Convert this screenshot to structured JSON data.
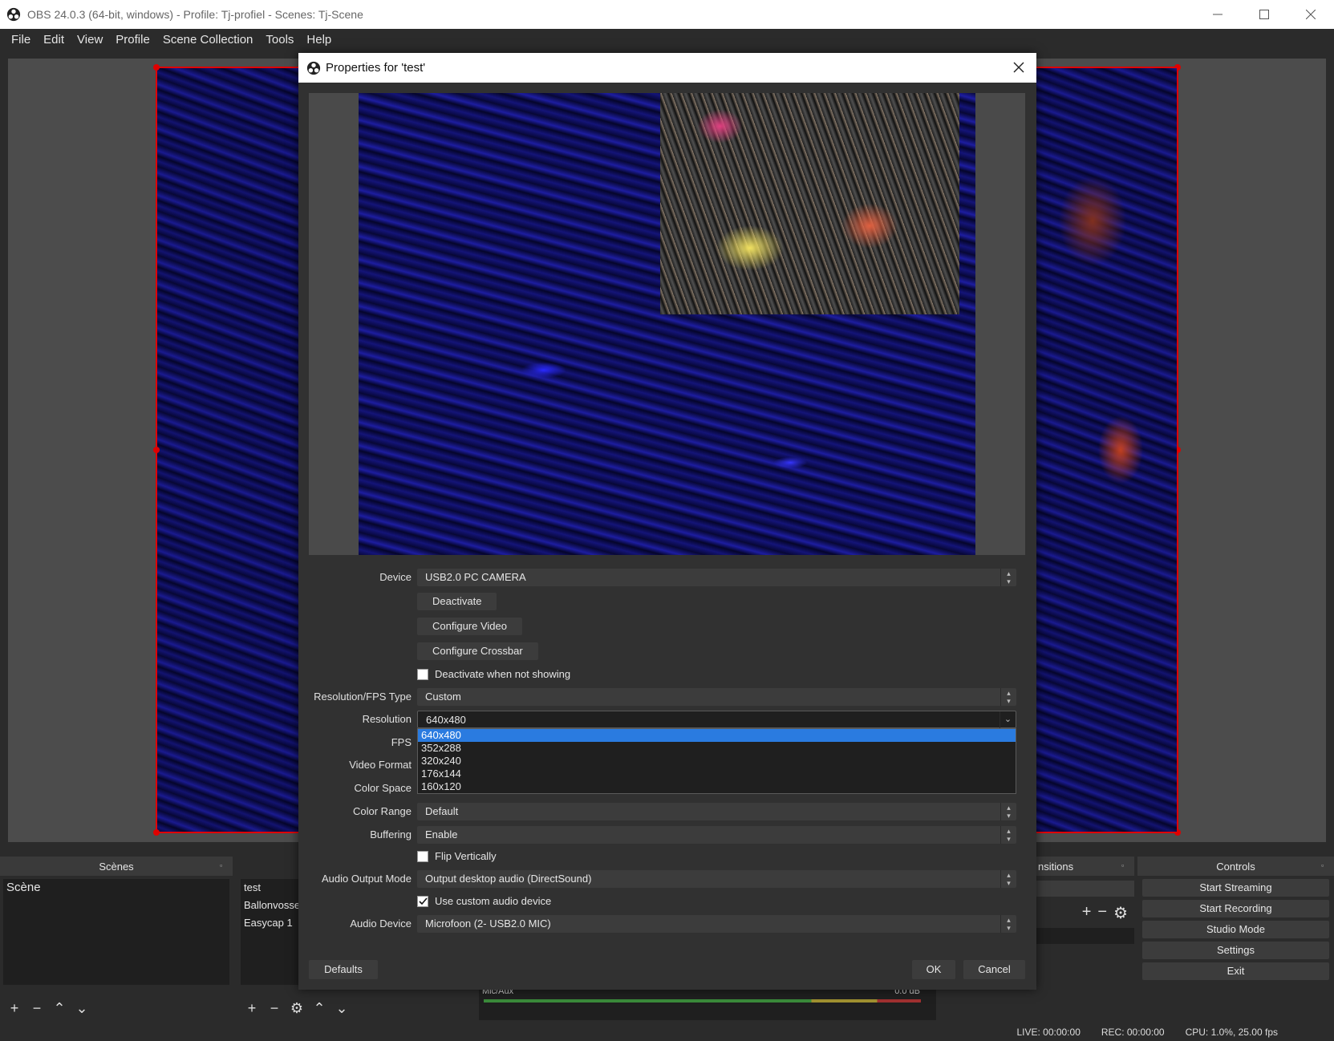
{
  "window": {
    "title": "OBS 24.0.3 (64-bit, windows) - Profile: Tj-profiel - Scenes: Tj-Scene"
  },
  "menu": [
    "File",
    "Edit",
    "View",
    "Profile",
    "Scene Collection",
    "Tools",
    "Help"
  ],
  "docks": {
    "scenes": {
      "header": "Scènes",
      "items": [
        "Scène"
      ]
    },
    "sources": {
      "items": [
        "test",
        "Ballonvosse",
        "Easycap 1"
      ]
    },
    "transitions": {
      "header_partial": "nsitions"
    },
    "controls": {
      "header": "Controls",
      "buttons": [
        "Start Streaming",
        "Start Recording",
        "Studio Mode",
        "Settings",
        "Exit"
      ]
    },
    "mixer": {
      "label": "Mic/Aux",
      "db": "0.0 dB"
    }
  },
  "status": {
    "live": "LIVE: 00:00:00",
    "rec": "REC: 00:00:00",
    "cpu": "CPU: 1.0%, 25.00 fps"
  },
  "dialog": {
    "title": "Properties for 'test'",
    "device_label": "Device",
    "device_value": "USB2.0 PC CAMERA",
    "deactivate_btn": "Deactivate",
    "configure_video_btn": "Configure Video",
    "configure_crossbar_btn": "Configure Crossbar",
    "deactivate_when_not_showing": "Deactivate when not showing",
    "res_fps_type_label": "Resolution/FPS Type",
    "res_fps_type_value": "Custom",
    "resolution_label": "Resolution",
    "resolution_value": "640x480",
    "resolution_options": [
      "640x480",
      "352x288",
      "320x240",
      "176x144",
      "160x120"
    ],
    "fps_label": "FPS",
    "video_format_label": "Video Format",
    "color_space_label": "Color Space",
    "color_range_label": "Color Range",
    "color_range_value": "Default",
    "buffering_label": "Buffering",
    "buffering_value": "Enable",
    "flip_vertically": "Flip Vertically",
    "audio_output_mode_label": "Audio Output Mode",
    "audio_output_mode_value": "Output desktop audio (DirectSound)",
    "use_custom_audio_device": "Use custom audio device",
    "audio_device_label": "Audio Device",
    "audio_device_value": "Microfoon (2- USB2.0 MIC)",
    "defaults_btn": "Defaults",
    "ok_btn": "OK",
    "cancel_btn": "Cancel"
  },
  "colors": {
    "selection": "#2a7be0",
    "source_border": "#e00000",
    "panel": "#2b2b2b"
  }
}
